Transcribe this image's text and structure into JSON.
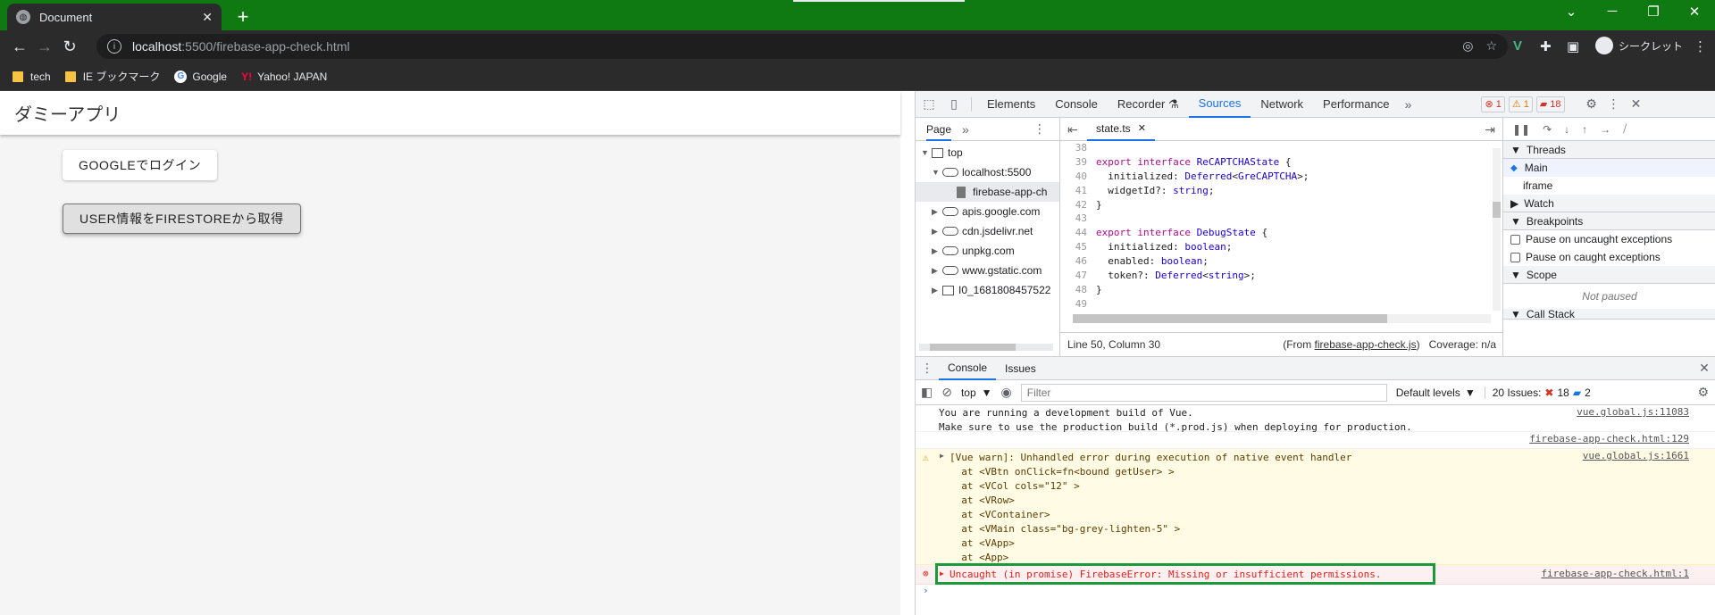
{
  "browser": {
    "tab_title": "Document",
    "url_host": "localhost",
    "url_path": ":5500/firebase-app-check.html",
    "incognito_label": "シークレット",
    "bookmarks": [
      "tech",
      "IE ブックマーク",
      "Google",
      "Yahoo! JAPAN"
    ],
    "accent_color": "#0f7a12"
  },
  "page": {
    "app_title": "ダミーアプリ",
    "login_button": "GOOGLEでログイン",
    "fetch_button": "USER情報をFIRESTOREから取得"
  },
  "devtools": {
    "tabs": [
      "Elements",
      "Console",
      "Recorder",
      "Sources",
      "Network",
      "Performance"
    ],
    "active_tab": "Sources",
    "badges": {
      "errors": "1",
      "warnings": "1",
      "issues": "18"
    },
    "navigator": {
      "tab": "Page",
      "items": [
        "top",
        "localhost:5500",
        "firebase-app-ch",
        "apis.google.com",
        "cdn.jsdelivr.net",
        "unpkg.com",
        "www.gstatic.com",
        "I0_1681808457522"
      ]
    },
    "editor": {
      "file_tab": "state.ts",
      "lines": [
        {
          "n": "38",
          "t": ""
        },
        {
          "n": "39",
          "t": "export interface ReCAPTCHAState {"
        },
        {
          "n": "40",
          "t": "  initialized: Deferred<GreCAPTCHA>;"
        },
        {
          "n": "41",
          "t": "  widgetId?: string;"
        },
        {
          "n": "42",
          "t": "}"
        },
        {
          "n": "43",
          "t": ""
        },
        {
          "n": "44",
          "t": "export interface DebugState {"
        },
        {
          "n": "45",
          "t": "  initialized: boolean;"
        },
        {
          "n": "46",
          "t": "  enabled: boolean;"
        },
        {
          "n": "47",
          "t": "  token?: Deferred<string>;"
        },
        {
          "n": "48",
          "t": "}"
        },
        {
          "n": "49",
          "t": ""
        }
      ],
      "status_position": "Line 50, Column 30",
      "status_from_prefix": "(From ",
      "status_from_file": "firebase-app-check.js",
      "status_from_suffix": ")",
      "coverage": "Coverage: n/a"
    },
    "debugger": {
      "threads_label": "Threads",
      "threads": [
        "Main",
        "iframe"
      ],
      "watch_label": "Watch",
      "breakpoints_label": "Breakpoints",
      "breakpoint_options": [
        "Pause on uncaught exceptions",
        "Pause on caught exceptions"
      ],
      "scope_label": "Scope",
      "scope_status": "Not paused",
      "callstack_label": "Call Stack"
    },
    "drawer": {
      "tabs": [
        "Console",
        "Issues"
      ],
      "context": "top",
      "filter_placeholder": "Filter",
      "levels": "Default levels",
      "issues_label": "20 Issues:",
      "issues_err": "18",
      "issues_info": "2",
      "messages": [
        {
          "kind": "info",
          "text": "You are running a development build of Vue.\nMake sure to use the production build (*.prod.js) when deploying for production.",
          "src": "vue.global.js:11083"
        },
        {
          "kind": "garble",
          "text": "",
          "src": "firebase-app-check.html:129"
        },
        {
          "kind": "warn",
          "text": "[Vue warn]: Unhandled error during execution of native event handler\n  at <VBtn onClick=fn<bound getUser> >\n  at <VCol cols=\"12\" >\n  at <VRow>\n  at <VContainer>\n  at <VMain class=\"bg-grey-lighten-5\" >\n  at <VApp>\n  at <App>",
          "src": "vue.global.js:1661"
        },
        {
          "kind": "err",
          "text": "Uncaught (in promise) FirebaseError: Missing or insufficient permissions.",
          "src": "firebase-app-check.html:1"
        }
      ]
    }
  }
}
